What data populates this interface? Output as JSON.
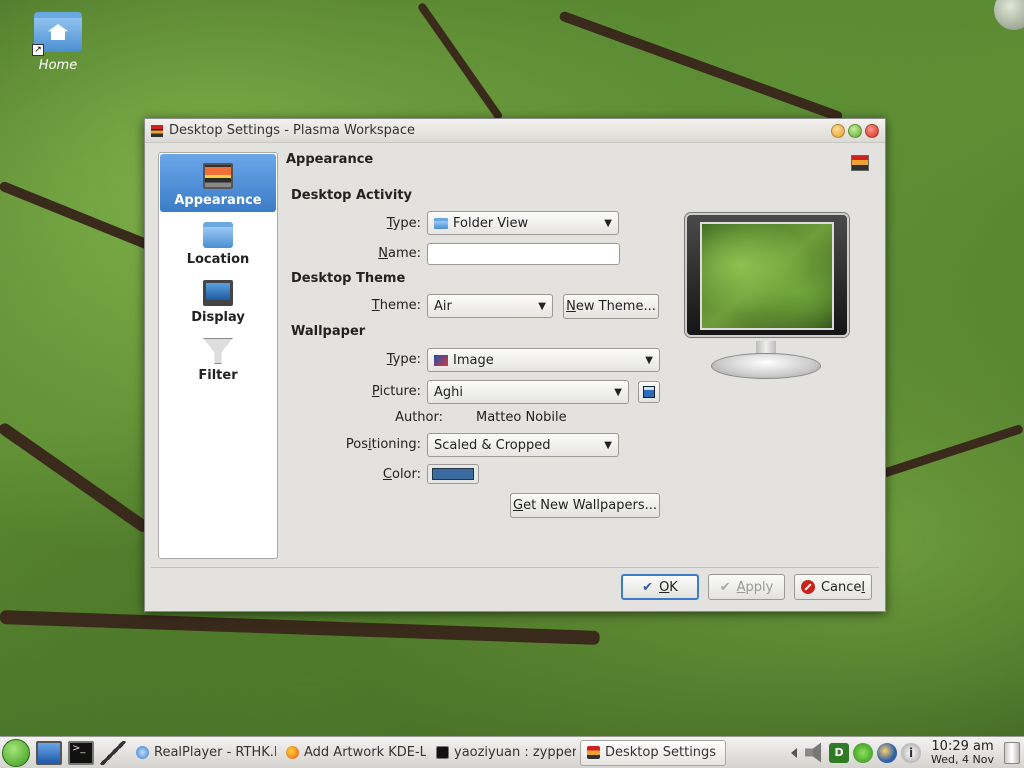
{
  "desktop": {
    "home_icon_label": "Home"
  },
  "window": {
    "title": "Desktop Settings - Plasma Workspace",
    "icon": "desktop-settings-icon"
  },
  "sidebar": {
    "items": [
      {
        "label": "Appearance",
        "icon": "appearance-icon",
        "active": true
      },
      {
        "label": "Location",
        "icon": "folder-icon",
        "active": false
      },
      {
        "label": "Display",
        "icon": "monitor-icon",
        "active": false
      },
      {
        "label": "Filter",
        "icon": "filter-funnel-icon",
        "active": false
      }
    ]
  },
  "page": {
    "header": "Appearance"
  },
  "desktop_activity": {
    "section_title": "Desktop Activity",
    "type_label_prefix": "",
    "type_label_underlined": "T",
    "type_label_rest": "ype:",
    "type_value": "Folder View",
    "name_label_prefix": "",
    "name_label_underlined": "N",
    "name_label_rest": "ame:",
    "name_value": ""
  },
  "desktop_theme": {
    "section_title": "Desktop Theme",
    "theme_label_prefix": "",
    "theme_label_underlined": "T",
    "theme_label_rest": "heme:",
    "theme_value": "Air",
    "new_theme_button_prefix": "",
    "new_theme_button_underlined": "N",
    "new_theme_button_rest": "ew Theme..."
  },
  "wallpaper": {
    "section_title": "Wallpaper",
    "type_label_prefix": "",
    "type_label_underlined": "T",
    "type_label_rest": "ype:",
    "type_value": "Image",
    "picture_label_prefix": "",
    "picture_label_underlined": "P",
    "picture_label_rest": "icture:",
    "picture_value": "Aghi",
    "author_label": "Author:",
    "author_value": "Matteo Nobile",
    "positioning_label_prefix": "Pos",
    "positioning_label_underlined": "i",
    "positioning_label_rest": "tioning:",
    "positioning_value": "Scaled & Cropped",
    "color_label_prefix": "",
    "color_label_underlined": "C",
    "color_label_rest": "olor:",
    "color_value": "#3b6aa0",
    "get_new_button_prefix": "",
    "get_new_button_underlined": "G",
    "get_new_button_rest": "et New Wallpapers..."
  },
  "buttons": {
    "ok_prefix": "",
    "ok_underlined": "O",
    "ok_rest": "K",
    "apply_prefix": "",
    "apply_underlined": "A",
    "apply_rest": "pply",
    "cancel_prefix": "Cance",
    "cancel_underlined": "l",
    "cancel_rest": ""
  },
  "taskbar": {
    "tasks": [
      {
        "label": "RealPlayer - RTHK.R",
        "icon": "realplayer-icon",
        "active": false
      },
      {
        "label": "Add Artwork KDE-L",
        "icon": "firefox-icon",
        "active": false
      },
      {
        "label": "yaoziyuan : zypper",
        "icon": "terminal-icon",
        "active": false
      },
      {
        "label": "Desktop Settings",
        "icon": "desktop-settings-icon",
        "active": true
      }
    ],
    "clock_time": "10:29 am",
    "clock_date": "Wed, 4 Nov",
    "tray_d_label": "D",
    "tray_info_label": "i"
  },
  "colors": {
    "accent": "#3c7cc8",
    "window_bg": "#e4e2de",
    "cancel_red": "#c8241a"
  }
}
